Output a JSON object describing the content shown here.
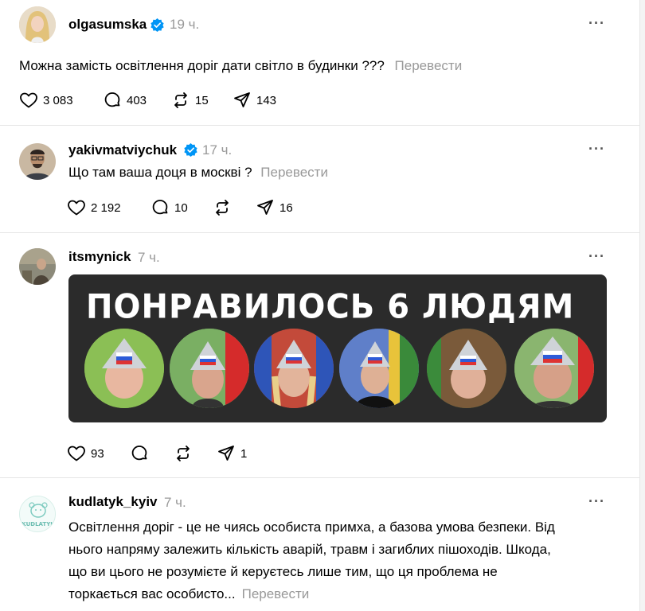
{
  "posts": [
    {
      "username": "olgasumska",
      "time": "19 ч.",
      "verified": true,
      "text": "Можна замість освітлення доріг дати світло в будинки ???",
      "translate": "Перевести",
      "likes": "3 083",
      "replies": "403",
      "reposts": "15",
      "shares": "143"
    },
    {
      "username": "yakivmatviychuk",
      "time": "17 ч.",
      "verified": true,
      "text": "Що там ваша доця в москві ?",
      "translate": "Перевести",
      "likes": "2 192",
      "replies": "10",
      "reposts": "",
      "shares": "16"
    },
    {
      "username": "itsmynick",
      "time": "7 ч.",
      "verified": false,
      "image_text": "ПОНРАВИЛОСЬ 6 ЛЮДЯМ",
      "likes": "93",
      "replies": "",
      "reposts": "",
      "shares": "1"
    },
    {
      "username": "kudlatyk_kyiv",
      "time": "7 ч.",
      "verified": false,
      "avatar_text": "KUDLATYK",
      "text_lines": [
        "Освітлення доріг - це не чиясь особиста примха, а базова умова безпеки. Від",
        "нього напряму залежить кількість аварій, травм і загиблих пішоходів. Шкода,",
        "що ви цього не розумієте й керуєтесь лише тим, що ця проблема не",
        "торкається вас особисто..."
      ],
      "translate": "Перевести"
    }
  ],
  "colors": {
    "verified": "#0095f6",
    "muted": "#999999",
    "banner_bg": "#2b2b2b"
  },
  "icons": [
    "heart-icon",
    "reply-icon",
    "repost-icon",
    "share-icon",
    "more-icon",
    "verified-badge-icon"
  ]
}
